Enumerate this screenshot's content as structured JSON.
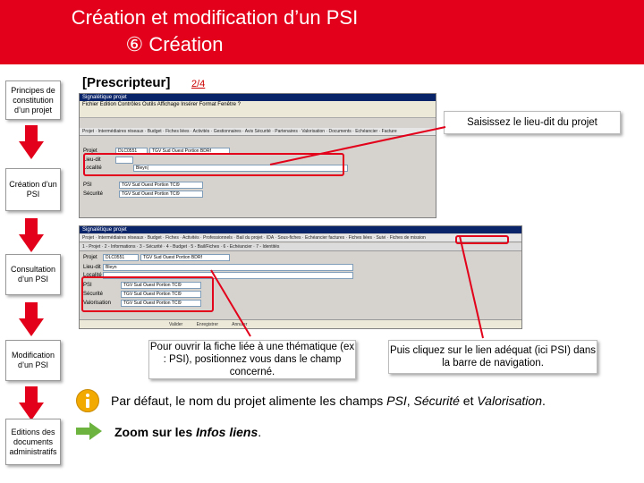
{
  "header": {
    "title": "Création et modification d’un PSI",
    "subtitle": "⑥ Création"
  },
  "sidebar": {
    "steps": [
      "Principes de constitution d’un projet",
      "Création d’un PSI",
      "Consultation d’un PSI",
      "Modification d’un PSI",
      "Editions des documents administratifs"
    ]
  },
  "section": {
    "title": "[Prescripteur]",
    "page": "2/4"
  },
  "screenshot1": {
    "window_title": "Signalétique projet",
    "menu": "Fichier Edition Contrôles Outils Affichage Insérer Format Fenêtre ?",
    "nav": "Projet · Intermédiaires réseaux · Budget · Fiches liées · Activités · Gestionnaires · Avis Sécurité · Partenaires · Valorisation · Documents · Echéancier · Facture",
    "rows": [
      {
        "label": "Projet",
        "code": "DLC0551",
        "value": "TGV Sud Ouest Portion BDRf"
      },
      {
        "label": "Lieu-dit",
        "code": "",
        "value": ""
      },
      {
        "label": "Localité",
        "code": "",
        "value": "Bleyn|"
      },
      {
        "label": "PSI",
        "code": "TGV Sud Ouest Portion TCI9",
        "value": ""
      },
      {
        "label": "Sécurité",
        "code": "TGV Sud Ouest Portion TCI9",
        "value": ""
      }
    ]
  },
  "screenshot2": {
    "window_title": "Signalétique projet",
    "nav": "Projet · Intermédiaires réseaux · Budget · Fiches · Activités · Professionnels · Bail du projet · IDA · Sous-fiches · Echéancier factures · Fiches liées · Suivi · Fiches de mission",
    "tabs": "1 - Projet · 2 - Informations · 3 - Sécurité · 4 - Budget · 5 - Bail/Fiches · 6 - Echéancier · 7 - Identités",
    "rows": [
      {
        "label": "Projet",
        "code": "DLC0551",
        "value": "TGV Sud Ouest Portion BDRf"
      },
      {
        "label": "Lieu-dit",
        "code": "Bleyn",
        "value": ""
      },
      {
        "label": "Localité",
        "code": "",
        "value": ""
      },
      {
        "label": "PSI",
        "code": "TGV Sud Ouest Portion TCI9",
        "value": ""
      },
      {
        "label": "Sécurité",
        "code": "TGV Sud Ouest Portion TCI9",
        "value": ""
      },
      {
        "label": "Valorisation",
        "code": "TGV Sud Ouest Portion TCI9",
        "value": ""
      }
    ],
    "bottom": "Valider Enregistrer Annuler"
  },
  "callouts": {
    "lieu_dit": "Saisissez le lieu-dit du projet",
    "fiche_liee": "Pour ouvrir la fiche liée à une thématique (ex : PSI), positionnez vous dans le champ concerné.",
    "lien": "Puis cliquez sur le lien adéquat (ici PSI) dans la barre de navigation."
  },
  "info": {
    "prefix": "Par défaut, le nom du projet alimente les champs ",
    "psi": "PSI",
    "sep1": ", ",
    "securite": "Sécurité",
    "sep2": " et ",
    "valorisation": "Valorisation",
    "suffix": "."
  },
  "zoom": {
    "prefix": "Zoom sur les ",
    "italic": "Infos liens",
    "suffix": "."
  },
  "colors": {
    "header": "#e2001a",
    "sidebar_arrow": "#e2001a",
    "highlight": "#e2001a"
  }
}
